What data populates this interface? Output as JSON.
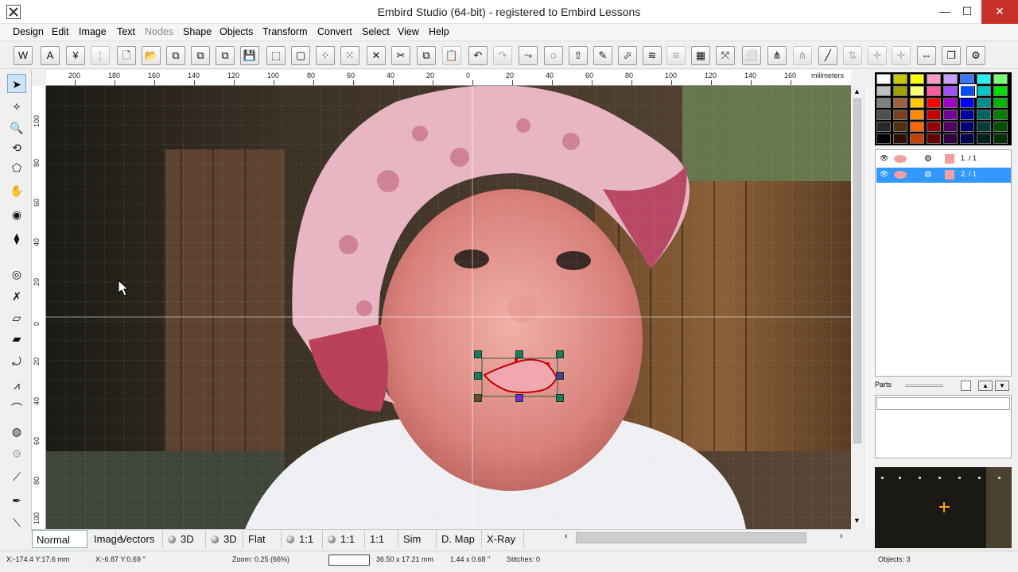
{
  "window": {
    "title": "Embird Studio (64-bit)  - registered to Embird Lessons",
    "min_glyph": "—",
    "max_glyph": "☐",
    "close_glyph": "✕"
  },
  "menu": {
    "items": [
      "Design",
      "Edit",
      "Image",
      "Text",
      "Nodes",
      "Shape",
      "Objects",
      "Transform",
      "Convert",
      "Select",
      "View",
      "Help"
    ],
    "disabled": [
      "Nodes"
    ]
  },
  "toolbar": {
    "buttons": [
      {
        "name": "embird-logo-icon",
        "glyph": "W"
      },
      {
        "name": "text-tool-icon",
        "glyph": "A"
      },
      {
        "name": "font-tool-icon",
        "glyph": "¥"
      },
      {
        "name": "monogram-icon",
        "glyph": "¦"
      },
      {
        "name": "new-icon",
        "glyph": "🗋"
      },
      {
        "name": "open-icon",
        "glyph": "📂"
      },
      {
        "name": "insert-icon",
        "glyph": "⧉"
      },
      {
        "name": "merge-icon",
        "glyph": "⧉"
      },
      {
        "name": "save-as-icon",
        "glyph": "⧉"
      },
      {
        "name": "save-icon",
        "glyph": "💾"
      },
      {
        "name": "frame-icon",
        "glyph": "⬚"
      },
      {
        "name": "select-box-icon",
        "glyph": "▢"
      },
      {
        "name": "select-all-icon",
        "glyph": "⁘"
      },
      {
        "name": "select-nodes-icon",
        "glyph": "⁙"
      },
      {
        "name": "delete-icon",
        "glyph": "✕"
      },
      {
        "name": "cut-icon",
        "glyph": "✂"
      },
      {
        "name": "copy-icon",
        "glyph": "⧉"
      },
      {
        "name": "paste-icon",
        "glyph": "📋"
      },
      {
        "name": "undo-icon",
        "glyph": "↶"
      },
      {
        "name": "redo-icon",
        "glyph": "↷"
      },
      {
        "name": "node-edit-icon",
        "glyph": "⤳"
      },
      {
        "name": "erase-icon",
        "glyph": "◌"
      },
      {
        "name": "arrow-up-icon",
        "glyph": "⇧"
      },
      {
        "name": "pipette-icon",
        "glyph": "✎"
      },
      {
        "name": "edit-object-icon",
        "glyph": "⬀"
      },
      {
        "name": "layers-icon",
        "glyph": "≋"
      },
      {
        "name": "layers-2-icon",
        "glyph": "≋"
      },
      {
        "name": "grid-icon",
        "glyph": "▦"
      },
      {
        "name": "transform-icon",
        "glyph": "⤧"
      },
      {
        "name": "shape-icon",
        "glyph": "⬜"
      },
      {
        "name": "stitch-icon",
        "glyph": "⋔"
      },
      {
        "name": "stitch-2-icon",
        "glyph": "⋔"
      },
      {
        "name": "line-icon",
        "glyph": "╱"
      },
      {
        "name": "arrows-icon",
        "glyph": "⇅"
      },
      {
        "name": "crosshair-icon",
        "glyph": "✛"
      },
      {
        "name": "crosshair-2-icon",
        "glyph": "✛"
      },
      {
        "name": "resize-icon",
        "glyph": "⇔"
      },
      {
        "name": "window-icon",
        "glyph": "❐"
      },
      {
        "name": "settings-icon",
        "glyph": "⚙"
      }
    ],
    "disabled_indices": [
      3,
      17,
      19,
      26,
      31,
      33,
      34,
      35
    ]
  },
  "left_tools": [
    {
      "name": "pointer-tool-icon",
      "glyph": "➤",
      "selected": true
    },
    {
      "name": "node-tool-icon",
      "glyph": "⟡"
    },
    {
      "name": "zoom-tool-icon",
      "glyph": "🔍"
    },
    {
      "name": "pan-tool-icon",
      "glyph": "⟲"
    },
    {
      "name": "polygon-tool-icon",
      "glyph": "⬠"
    },
    {
      "name": "hand-tool-icon",
      "glyph": "✋"
    },
    {
      "name": "fill-tool-icon",
      "glyph": "◉"
    },
    {
      "name": "satin-tool-icon",
      "glyph": "⧫"
    },
    {
      "name": "ring-tool-icon",
      "glyph": "◎"
    },
    {
      "name": "cross-tool-icon",
      "glyph": "✗"
    },
    {
      "name": "shape-tool-icon",
      "glyph": "▱"
    },
    {
      "name": "column-tool-icon",
      "glyph": "▰"
    },
    {
      "name": "curve-tool-icon",
      "glyph": "⤾"
    },
    {
      "name": "zigzag-tool-icon",
      "glyph": "⩘"
    },
    {
      "name": "arc-tool-icon",
      "glyph": "⌒"
    },
    {
      "name": "stamp-tool-icon",
      "glyph": "◍"
    },
    {
      "name": "gear-tool-icon",
      "glyph": "⚙",
      "disabled": true
    },
    {
      "name": "measure-tool-icon",
      "glyph": "⟋"
    },
    {
      "name": "pen-tool-icon",
      "glyph": "✒"
    },
    {
      "name": "ruler-tool-icon",
      "glyph": "⟍"
    }
  ],
  "ruler": {
    "unit": "milimeters",
    "top_labels": [
      "200",
      "180",
      "160",
      "140",
      "120",
      "100",
      "80",
      "60",
      "40",
      "20",
      "0",
      "20",
      "40",
      "60",
      "80",
      "100",
      "120",
      "140",
      "160"
    ],
    "left_labels": [
      "100",
      "80",
      "60",
      "40",
      "20",
      "0",
      "20",
      "40",
      "60",
      "80",
      "100"
    ]
  },
  "view_tabs": [
    {
      "label": "Normal",
      "selected": true
    },
    {
      "label": "Image"
    },
    {
      "label": "Vectors"
    },
    {
      "label": "3D",
      "ball": true
    },
    {
      "label": "3D",
      "ball": true
    },
    {
      "label": "Flat"
    },
    {
      "label": "1:1",
      "ball": true
    },
    {
      "label": "1:1",
      "ball": true
    },
    {
      "label": "1:1"
    },
    {
      "label": "Sim"
    },
    {
      "label": "D. Map"
    },
    {
      "label": "X-Ray"
    }
  ],
  "status": {
    "pos_mm": "X:-174.4  Y:17.6 mm",
    "pos_in": "X:-6.87  Y:0.69 \"",
    "zoom": "Zoom: 0.25 (66%)",
    "size_mm": "36.50 x 17.21 mm",
    "size_in": "1.44 x 0.68 \"",
    "stitches": "Stitches: 0",
    "objects": "Objects: 3"
  },
  "objects_panel": {
    "rows": [
      {
        "label": "1.  / 1",
        "selected": false,
        "swatch": "#f0a0a0"
      },
      {
        "label": "2.  / 1",
        "selected": true,
        "swatch": "#f0a0a0"
      }
    ]
  },
  "parts": {
    "label": "Parts"
  },
  "colors": {
    "accent": "#1e90ff",
    "selection_row": "#3399ff",
    "shape_stroke": "#cc0000",
    "handle": "#1e7a5c"
  },
  "palette": [
    "#ffffff",
    "#c8c800",
    "#ffff00",
    "#ff9bc8",
    "#c8a0ff",
    "#3c78ff",
    "#28f0f0",
    "#78ff78",
    "#c0c0c0",
    "#a0a000",
    "#ffff78",
    "#ff5aa0",
    "#a050ff",
    "#0050ff",
    "#00c8c8",
    "#00e000",
    "#808080",
    "#a06040",
    "#ffc800",
    "#ff0000",
    "#a000c8",
    "#0000ff",
    "#008c8c",
    "#00b400",
    "#505050",
    "#784020",
    "#ff8c00",
    "#c80000",
    "#780096",
    "#0000a0",
    "#006464",
    "#008000",
    "#282828",
    "#503010",
    "#ff6400",
    "#960000",
    "#500064",
    "#000078",
    "#003c3c",
    "#005000",
    "#000000",
    "#301000",
    "#c84000",
    "#640000",
    "#300040",
    "#000050",
    "#002020",
    "#003000"
  ]
}
